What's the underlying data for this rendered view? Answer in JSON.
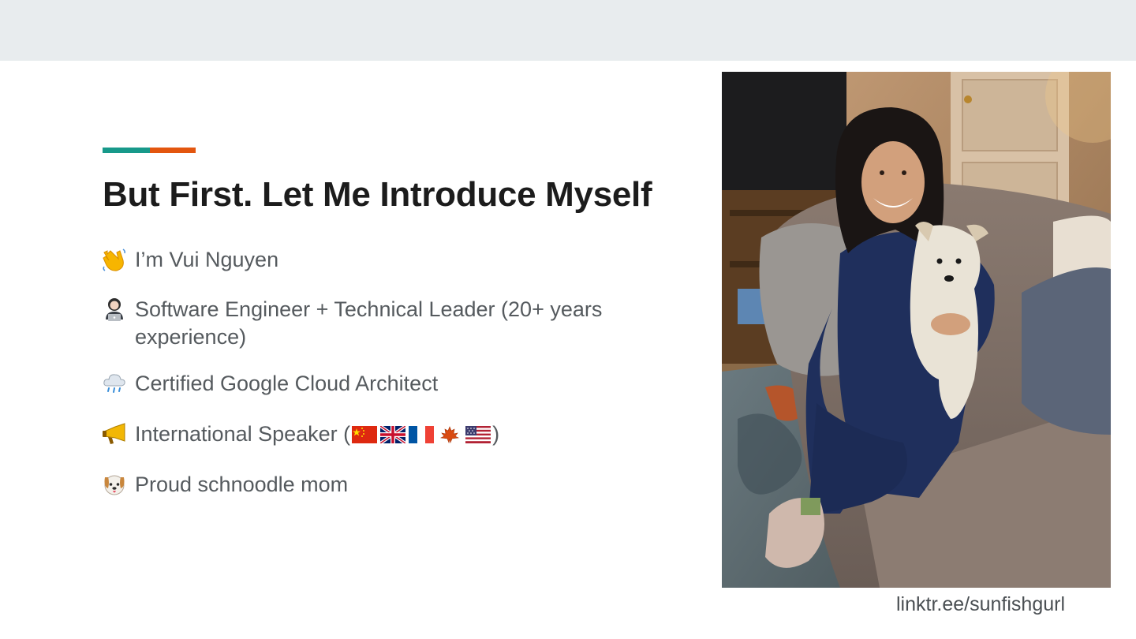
{
  "slide": {
    "title": "But First. Let Me Introduce Myself",
    "link": "linktr.ee/sunfishgurl"
  },
  "colors": {
    "top_band": "#e8ecee",
    "accent_teal": "#17998a",
    "accent_orange": "#e3560f",
    "title": "#1c1c1c",
    "body_text": "#555a5e"
  },
  "bullets": [
    {
      "icon": "waving-hand-icon",
      "text": "I’m Vui Nguyen"
    },
    {
      "icon": "technologist-icon",
      "text": "Software Engineer + Technical Leader (20+ years experience)"
    },
    {
      "icon": "cloud-rain-icon",
      "text": "Certified Google Cloud Architect"
    },
    {
      "icon": "megaphone-icon",
      "text_before": "International Speaker (",
      "text_after": ")",
      "flags": [
        "china-flag-icon",
        "uk-flag-icon",
        "france-flag-icon",
        "maple-leaf-icon",
        "usa-flag-icon"
      ]
    },
    {
      "icon": "dog-face-icon",
      "text": "Proud schnoodle mom"
    }
  ],
  "photo": {
    "icon": "profile-photo"
  }
}
